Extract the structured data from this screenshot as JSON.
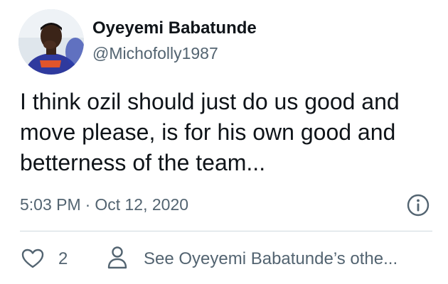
{
  "author": {
    "display_name": "Oyeyemi Babatunde",
    "handle": "@Michofolly1987"
  },
  "tweet": {
    "text": "I think ozil should just do us good and move please, is for his own good and betterness of the team...",
    "time": "5:03 PM",
    "separator": "·",
    "date": "Oct 12, 2020"
  },
  "actions": {
    "like_count": "2",
    "see_others_label": "See Oyeyemi Babatunde’s othe..."
  },
  "icons": {
    "info": "info-icon",
    "like": "heart-icon",
    "profile": "person-icon"
  },
  "colors": {
    "text_primary": "#0f1419",
    "text_secondary": "#536471",
    "divider": "#cfd9de"
  }
}
